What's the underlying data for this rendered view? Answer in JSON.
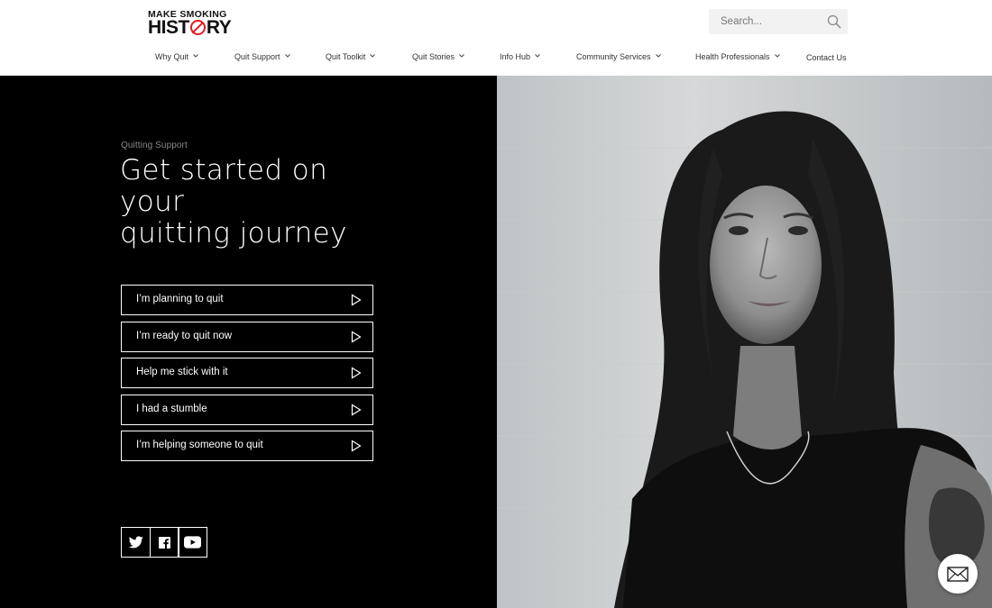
{
  "logo": {
    "top_text": "MAKE SMOKING",
    "bottom_text_a": "HIST",
    "bottom_text_b": "RY",
    "brand_red": "#e31b23"
  },
  "search": {
    "placeholder": "Search..."
  },
  "nav": {
    "items": [
      {
        "label": "Why Quit",
        "has_dropdown": true
      },
      {
        "label": "Quit Support",
        "has_dropdown": true
      },
      {
        "label": "Quit Toolkit",
        "has_dropdown": true
      },
      {
        "label": "Quit Stories",
        "has_dropdown": true
      },
      {
        "label": "Info Hub",
        "has_dropdown": true
      },
      {
        "label": "Community Services",
        "has_dropdown": true
      },
      {
        "label": "Health Professionals",
        "has_dropdown": true
      },
      {
        "label": "Contact Us",
        "has_dropdown": false
      }
    ]
  },
  "hero": {
    "eyebrow": "Quitting Support",
    "headline_line1": "Get started on your",
    "headline_line2": "quitting journey",
    "options": [
      {
        "label": "I’m planning to quit",
        "icon": "play-arrow-icon"
      },
      {
        "label": "I’m ready to quit now",
        "icon": "play-arrow-icon"
      },
      {
        "label": "Help me stick with it",
        "icon": "play-arrow-icon"
      },
      {
        "label": "I had a stumble",
        "icon": "play-arrow-icon"
      },
      {
        "label": "I’m helping someone to quit",
        "icon": "play-arrow-icon"
      }
    ],
    "social": [
      "twitter-icon",
      "facebook-icon",
      "youtube-icon"
    ],
    "background": "#000000"
  },
  "photo": {
    "subject": "portrait-photo"
  },
  "fab": {
    "icon": "mail-icon"
  }
}
